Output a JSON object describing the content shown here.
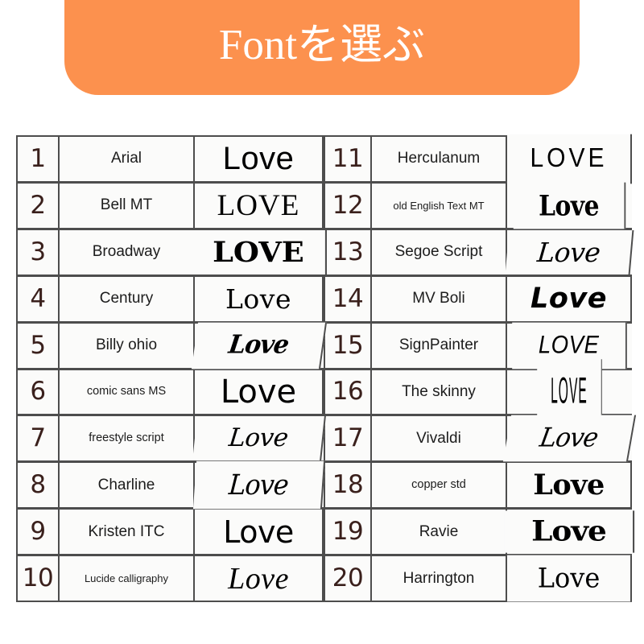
{
  "header": {
    "title": "Fontを選ぶ",
    "background_color": "#fc914e",
    "text_color": "#ffffff"
  },
  "table": {
    "border_color": "#4d4d4d",
    "cell_background": "#fbfbfa",
    "number_color": "#3a201c",
    "sample_word": "Love",
    "columns": [
      "number",
      "font_name",
      "sample"
    ],
    "rows": [
      {
        "number": "1",
        "font_name": "Arial",
        "sample": "Love",
        "name_size": "normal"
      },
      {
        "number": "2",
        "font_name": "Bell MT",
        "sample": "LOVE",
        "name_size": "normal"
      },
      {
        "number": "3",
        "font_name": "Broadway",
        "sample": "LOVE",
        "name_size": "normal"
      },
      {
        "number": "4",
        "font_name": "Century",
        "sample": "Love",
        "name_size": "normal"
      },
      {
        "number": "5",
        "font_name": "Billy ohio",
        "sample": "Love",
        "name_size": "normal"
      },
      {
        "number": "6",
        "font_name": "comic sans MS",
        "sample": "Love",
        "name_size": "small"
      },
      {
        "number": "7",
        "font_name": "freestyle script",
        "sample": "Love",
        "name_size": "small"
      },
      {
        "number": "8",
        "font_name": "Charline",
        "sample": "Love",
        "name_size": "normal"
      },
      {
        "number": "9",
        "font_name": "Kristen ITC",
        "sample": "Love",
        "name_size": "normal"
      },
      {
        "number": "10",
        "font_name": "Lucide calligraphy",
        "sample": "Love",
        "name_size": "xsmall"
      },
      {
        "number": "11",
        "font_name": "Herculanum",
        "sample": "LOVE",
        "name_size": "normal"
      },
      {
        "number": "12",
        "font_name": "old English Text MT",
        "sample": "Love",
        "name_size": "xsmall"
      },
      {
        "number": "13",
        "font_name": "Segoe Script",
        "sample": "Love",
        "name_size": "normal"
      },
      {
        "number": "14",
        "font_name": "MV Boli",
        "sample": "Love",
        "name_size": "normal"
      },
      {
        "number": "15",
        "font_name": "SignPainter",
        "sample": "LOVE",
        "name_size": "normal"
      },
      {
        "number": "16",
        "font_name": "The skinny",
        "sample": "LOVE",
        "name_size": "normal"
      },
      {
        "number": "17",
        "font_name": "Vivaldi",
        "sample": "Love",
        "name_size": "normal"
      },
      {
        "number": "18",
        "font_name": "copper std",
        "sample": "Love",
        "name_size": "small"
      },
      {
        "number": "19",
        "font_name": "Ravie",
        "sample": "Love",
        "name_size": "normal"
      },
      {
        "number": "20",
        "font_name": "Harrington",
        "sample": "Love",
        "name_size": "normal"
      }
    ]
  }
}
